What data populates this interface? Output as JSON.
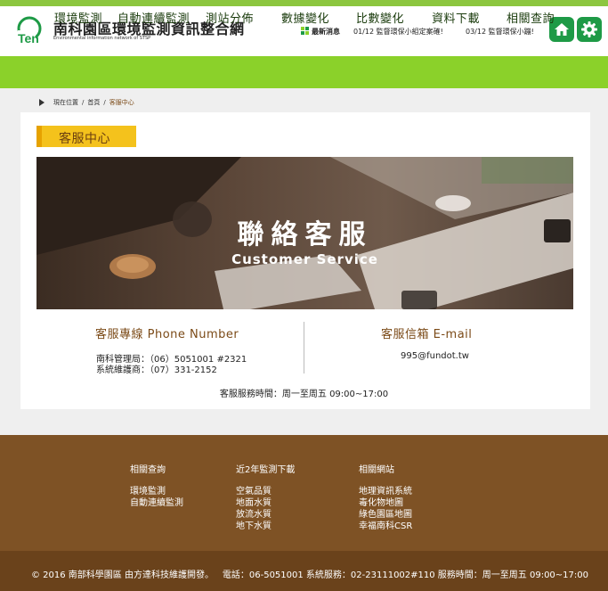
{
  "header": {
    "title": "南科園區環境監測資訊整合網",
    "subtitle": "Environmental information network of STSP",
    "logo_text": "Ten",
    "news_label": "最新消息",
    "news": [
      "01/12 監督環保小組定案確!",
      "03/12 監督環保小蹦!"
    ],
    "home_icon": "home-icon",
    "settings_icon": "gear-icon"
  },
  "nav": [
    "環境監測",
    "自動連續監測",
    "測站分佈",
    "數據變化",
    "比數變化",
    "資料下載",
    "相關查詢"
  ],
  "breadcrumb": {
    "label": "現在位置",
    "sep": "/",
    "home": "首頁",
    "current": "客服中心"
  },
  "page_title": "客服中心",
  "banner": {
    "title": "聯絡客服",
    "subtitle": "Customer Service"
  },
  "contact": {
    "phone_heading": "客服專線 Phone Number",
    "phone_lines": [
      "南科管理局：（06）5051001  #2321",
      "系統維護商：（07）331-2152"
    ],
    "email_heading": "客服信箱   E-mail",
    "email": "995@fundot.tw",
    "hours": "客服服務時間：周一至周五 09:00~17:00"
  },
  "footer": {
    "columns": [
      {
        "heading": "相關查詢",
        "links": [
          "環境監測",
          "自動連續監測"
        ]
      },
      {
        "heading": "近2年監測下載",
        "links": [
          "空氣品質",
          "地面水質",
          "放流水質",
          "地下水質"
        ]
      },
      {
        "heading": "相關網站",
        "links": [
          "地理資訊系統",
          "毒化物地圖",
          "綠色園區地圖",
          "幸福南科CSR"
        ]
      }
    ],
    "copyright": "© 2016 南部科學園區    由方達科技維護開發。",
    "contact": "電話：06-5051001    系統服務：02-23111002#110    服務時間：周一至周五 09:00~17:00"
  },
  "colors": {
    "brand_green": "#8bd12a",
    "dark_green": "#1e9a46",
    "footer_brown": "#7e5225",
    "tag_yellow": "#f4c21c"
  }
}
